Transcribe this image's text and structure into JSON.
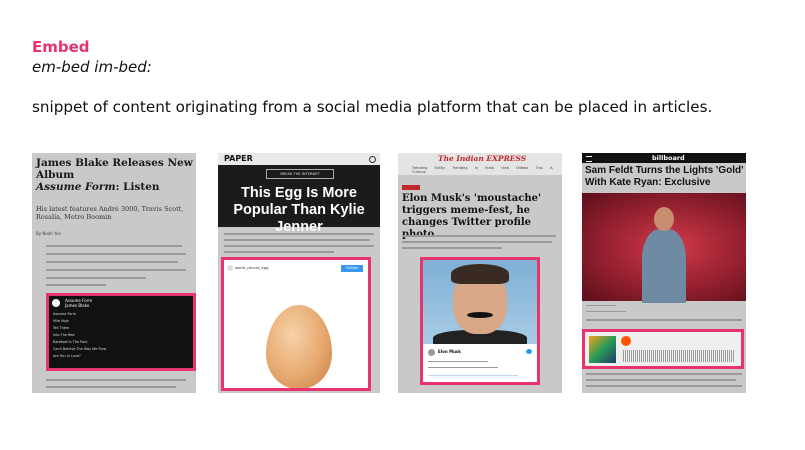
{
  "term": "Embed",
  "pronunciation": "em-bed im-bed:",
  "definition": "snippet of content originating from a social media platform that can be placed in articles.",
  "colors": {
    "accent": "#e8336d"
  },
  "examples": [
    {
      "title": "James Blake Releases New Album",
      "title_italic": "Assume Form",
      "title_suffix": ": Listen",
      "subtitle": "His latest features André 3000, Travis Scott, Rosalía, Metro Boomin",
      "byline": "By Noah Yoo",
      "embed_header": "Assume Form\nJames Blake",
      "tracks": [
        "Assume Form",
        "Mile High",
        "Tell Them",
        "Into The Red",
        "Barefoot In The Park",
        "Can't Believe The Way We Flow",
        "Are You In Love?"
      ]
    },
    {
      "logo": "PAPER",
      "button": "BREAK THE INTERNET",
      "headline": "This Egg Is More Popular Than Kylie Jenner",
      "user": "world_record_egg",
      "follow": "Follow"
    },
    {
      "logo": "The Indian EXPRESS",
      "nav": "Trending Entity Trending in India Viral Videos This is Curious",
      "headline": "Elon Musk's 'moustache' triggers meme-fest, he changes Twitter profile photo",
      "tweet_name": "Elon Musk"
    },
    {
      "logo": "billboard",
      "headline": "Sam Feldt Turns the Lights 'Gold' With Kate Ryan: Exclusive"
    }
  ]
}
